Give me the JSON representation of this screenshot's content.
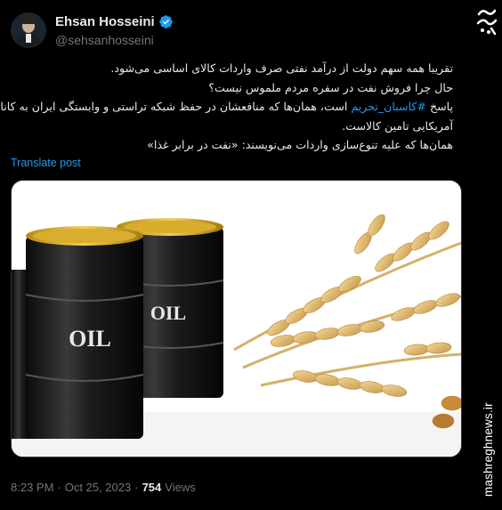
{
  "author": {
    "name": "Ehsan Hosseini",
    "handle": "@sehsanhosseini"
  },
  "tweet": {
    "line1": "تقریبا همه سهم دولت از درآمد نفتی صرف واردات کالای اساسی می‌شود.",
    "line2": "حال چرا فروش نفت در سفره مردم ملموس نیست؟",
    "line3_prefix": "پاسخ ",
    "hashtag": "#کاسبان_تحریم",
    "line3_suffix": " است، همان‌ها که منافعشان در حفظ شبکه تراستی و وابستگی ایران به کانال",
    "line4": "آمریکایی تامین کالاست.",
    "line5": "همان‌ها که علیه تنوع‌سازی واردات می‌نویسند: «نفت در برابر غذا»"
  },
  "translate_label": "Translate post",
  "media": {
    "barrel_label": "OIL"
  },
  "meta": {
    "time": "8:23 PM",
    "separator": "·",
    "date": "Oct 25, 2023",
    "views_count": "754",
    "views_label": "Views"
  },
  "watermark": {
    "site": "mashreghnews.ir"
  },
  "colors": {
    "background": "#000000",
    "text": "#e7e9ea",
    "secondary": "#71767b",
    "accent": "#1d9bf0"
  }
}
